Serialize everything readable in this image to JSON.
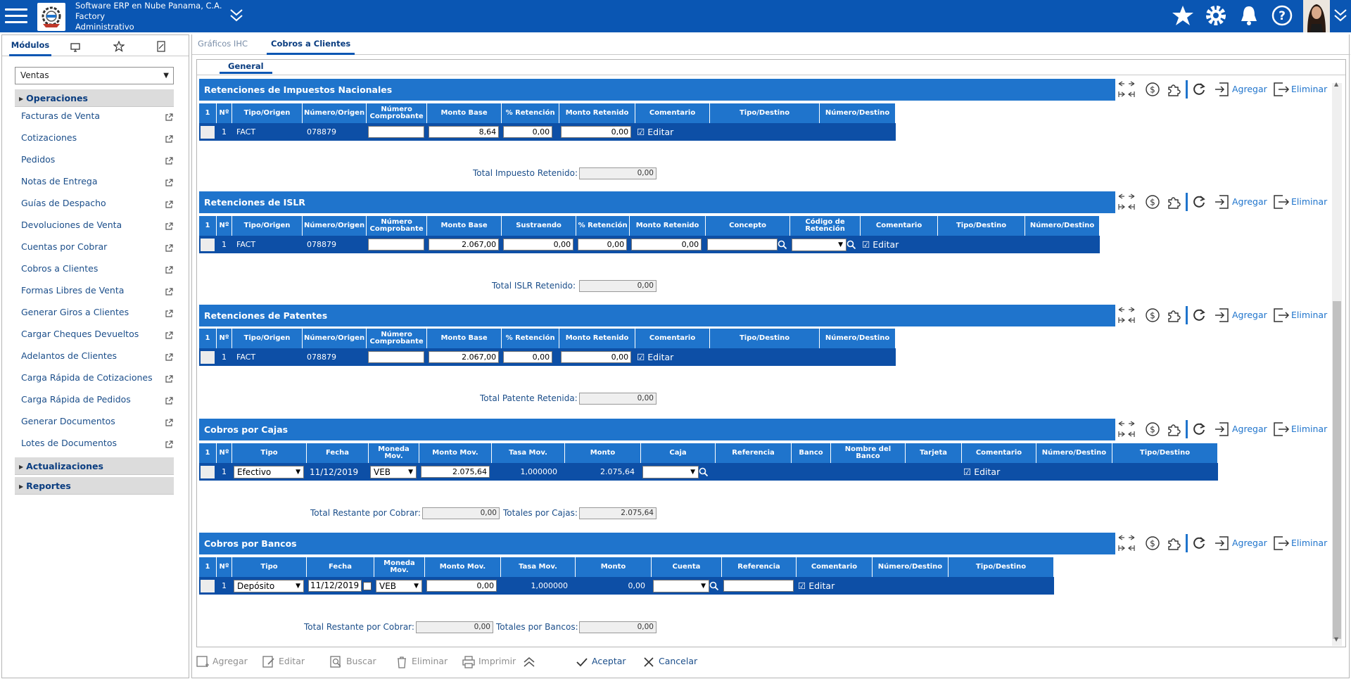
{
  "header": {
    "company_line1": "Software ERP en Nube Panama, C.A.",
    "company_line2": "Factory",
    "company_line3": "Administrativo",
    "icons": [
      "menu-icon",
      "logo",
      "chevron-down-icon",
      "star-icon",
      "gear-icon",
      "bell-icon",
      "help-icon",
      "avatar"
    ]
  },
  "sidebar": {
    "tabs": {
      "modulos": "Módulos"
    },
    "module_selected": "Ventas",
    "operaciones": "Operaciones",
    "items": [
      "Facturas de Venta",
      "Cotizaciones",
      "Pedidos",
      "Notas de Entrega",
      "Guías de Despacho",
      "Devoluciones de Venta",
      "Cuentas por Cobrar",
      "Cobros a Clientes",
      "Formas Libres de Venta",
      "Generar Giros a Clientes",
      "Cargar Cheques Devueltos",
      "Adelantos de Clientes",
      "Carga Rápida de Cotizaciones",
      "Carga Rápida de Pedidos",
      "Generar Documentos",
      "Lotes de Documentos"
    ],
    "actualizaciones": "Actualizaciones",
    "reportes": "Reportes"
  },
  "main_tabs": {
    "graficos": "Gráficos IHC",
    "cobros": "Cobros a Clientes"
  },
  "inner_tab": "General",
  "toolbar": {
    "agregar": "Agregar",
    "eliminar": "Eliminar"
  },
  "common": {
    "edit": "Editar",
    "chk_col": "1",
    "row_no": "1"
  },
  "sec1": {
    "title": "Retenciones de Impuestos Nacionales",
    "headers": [
      "1",
      "Nº",
      "Tipo/Origen",
      "Número/Origen",
      "Número Comprobante",
      "Monto Base",
      "% Retención",
      "Monto Retenido",
      "Comentario",
      "Tipo/Destino",
      "Número/Destino"
    ],
    "row": {
      "no": "1",
      "tipo": "FACT",
      "numero": "078879",
      "comprobante": "",
      "base": "8,64",
      "pct": "0,00",
      "retenido": "0,00"
    },
    "total_label": "Total Impuesto Retenido:",
    "total_value": "0,00"
  },
  "sec2": {
    "title": "Retenciones de ISLR",
    "headers": [
      "1",
      "Nº",
      "Tipo/Origen",
      "Número/Origen",
      "Número Comprobante",
      "Monto Base",
      "Sustraendo",
      "% Retención",
      "Monto Retenido",
      "Concepto",
      "Código de Retención",
      "Comentario",
      "Tipo/Destino",
      "Número/Destino"
    ],
    "row": {
      "no": "1",
      "tipo": "FACT",
      "numero": "078879",
      "comprobante": "",
      "base": "2.067,00",
      "sustraendo": "0,00",
      "pct": "0,00",
      "retenido": "0,00",
      "concepto": "",
      "codigo": ""
    },
    "total_label": "Total ISLR Retenido:",
    "total_value": "0,00"
  },
  "sec3": {
    "title": "Retenciones de Patentes",
    "headers": [
      "1",
      "Nº",
      "Tipo/Origen",
      "Número/Origen",
      "Número Comprobante",
      "Monto Base",
      "% Retención",
      "Monto Retenido",
      "Comentario",
      "Tipo/Destino",
      "Número/Destino"
    ],
    "row": {
      "no": "1",
      "tipo": "FACT",
      "numero": "078879",
      "comprobante": "",
      "base": "2.067,00",
      "pct": "0,00",
      "retenido": "0,00"
    },
    "total_label": "Total Patente Retenida:",
    "total_value": "0,00"
  },
  "sec4": {
    "title": "Cobros por Cajas",
    "headers": [
      "1",
      "Nº",
      "Tipo",
      "Fecha",
      "Moneda Mov.",
      "Monto Mov.",
      "Tasa Mov.",
      "Monto",
      "Caja",
      "Referencia",
      "Banco",
      "Nombre del Banco",
      "Tarjeta",
      "Comentario",
      "Número/Destino",
      "Tipo/Destino"
    ],
    "row": {
      "no": "1",
      "tipo": "Efectivo",
      "fecha": "11/12/2019",
      "moneda": "VEB",
      "monto_mov": "2.075,64",
      "tasa": "1,000000",
      "monto": "2.075,64",
      "caja": ""
    },
    "restante_label": "Total Restante por Cobrar:",
    "restante_value": "0,00",
    "total_label": "Totales por Cajas:",
    "total_value": "2.075,64"
  },
  "sec5": {
    "title": "Cobros por Bancos",
    "headers": [
      "1",
      "Nº",
      "Tipo",
      "Fecha",
      "Moneda Mov.",
      "Monto Mov.",
      "Tasa Mov.",
      "Monto",
      "Cuenta",
      "Referencia",
      "Comentario",
      "Número/Destino",
      "Tipo/Destino"
    ],
    "row": {
      "no": "1",
      "tipo": "Depósito",
      "fecha": "11/12/2019",
      "moneda": "VEB",
      "monto_mov": "0,00",
      "tasa": "1,000000",
      "monto": "0,00",
      "cuenta": "",
      "referencia": ""
    },
    "restante_label": "Total Restante por Cobrar:",
    "restante_value": "0,00",
    "total_label": "Totales por Bancos:",
    "total_value": "0,00"
  },
  "bottom": {
    "agregar": "Agregar",
    "editar": "Editar",
    "buscar": "Buscar",
    "eliminar": "Eliminar",
    "imprimir": "Imprimir",
    "aceptar": "Aceptar",
    "cancelar": "Cancelar"
  }
}
